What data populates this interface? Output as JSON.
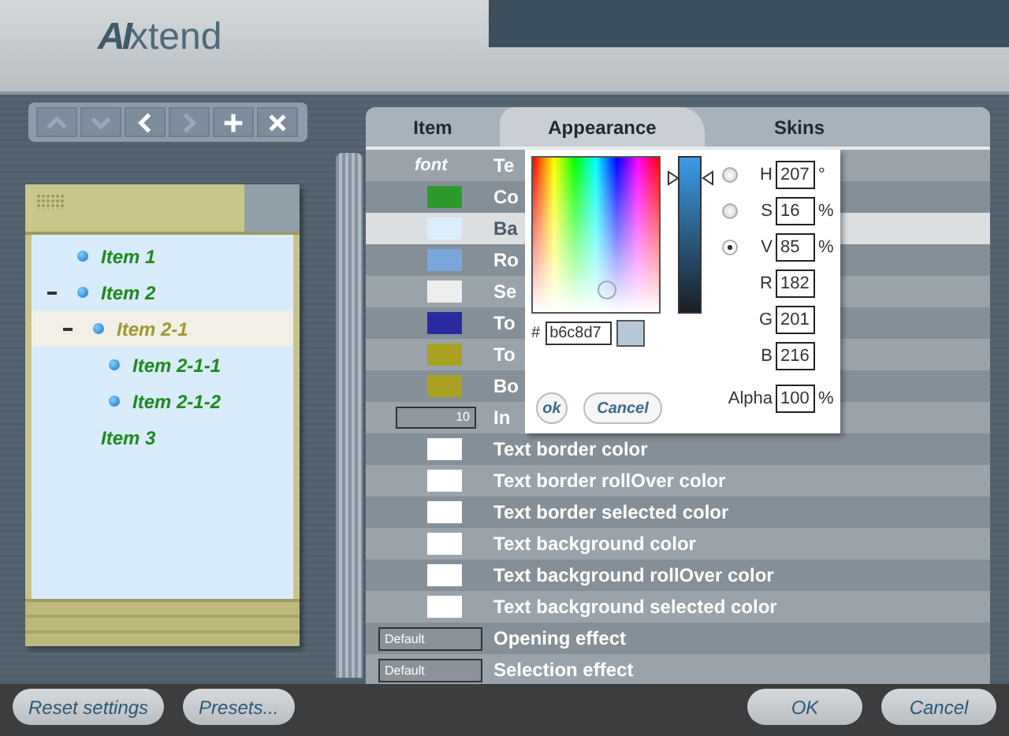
{
  "logo": {
    "mark": "AI",
    "text": "xtend"
  },
  "toolbar": [
    {
      "kind": "up",
      "disabled": true
    },
    {
      "kind": "down",
      "disabled": true
    },
    {
      "kind": "left",
      "disabled": false
    },
    {
      "kind": "right",
      "disabled": true
    },
    {
      "kind": "add",
      "disabled": false
    },
    {
      "kind": "remove",
      "disabled": false
    }
  ],
  "tree": {
    "items": [
      {
        "label": "Item 1",
        "bullet": true,
        "selected": false
      },
      {
        "label": "Item 2",
        "bullet": true,
        "selected": false,
        "expanded": true,
        "children": [
          {
            "label": "Item 2-1",
            "bullet": true,
            "selected": true,
            "expanded": true,
            "children": [
              {
                "label": "Item 2-1-1",
                "bullet": true,
                "selected": false
              },
              {
                "label": "Item 2-1-2",
                "bullet": true,
                "selected": false
              }
            ]
          }
        ]
      },
      {
        "label": "Item 3",
        "bullet": false,
        "selected": false
      }
    ]
  },
  "tabs": [
    {
      "label": "Item",
      "selected": false
    },
    {
      "label": "Appearance",
      "selected": true
    },
    {
      "label": "Skins",
      "selected": false
    }
  ],
  "rows": [
    {
      "kind": "font",
      "value": "font",
      "label": "Te",
      "selected": false
    },
    {
      "kind": "color",
      "color": "#2e9a2e",
      "label": "Co",
      "selected": false
    },
    {
      "kind": "color",
      "color": "#dceefc",
      "label": "Ba",
      "selected": true
    },
    {
      "kind": "color",
      "color": "#7aa6dc",
      "label": "Ro",
      "selected": false
    },
    {
      "kind": "color",
      "color": "#eeeeee",
      "label": "Se",
      "selected": false
    },
    {
      "kind": "color",
      "color": "#2a2aa0",
      "label": "To",
      "selected": false
    },
    {
      "kind": "color",
      "color": "#a8a020",
      "label": "To",
      "selected": false
    },
    {
      "kind": "color",
      "color": "#a8a020",
      "label": "Bo",
      "selected": false
    },
    {
      "kind": "number",
      "value": "10",
      "label": "In",
      "selected": false
    },
    {
      "kind": "color",
      "color": "#ffffff",
      "label": "Text border color",
      "selected": false
    },
    {
      "kind": "color",
      "color": "#ffffff",
      "label": "Text border rollOver color",
      "selected": false
    },
    {
      "kind": "color",
      "color": "#ffffff",
      "label": "Text border selected color",
      "selected": false
    },
    {
      "kind": "color",
      "color": "#ffffff",
      "label": "Text background color",
      "selected": false
    },
    {
      "kind": "color",
      "color": "#ffffff",
      "label": "Text background rollOver color",
      "selected": false
    },
    {
      "kind": "color",
      "color": "#ffffff",
      "label": "Text background selected color",
      "selected": false
    },
    {
      "kind": "select",
      "value": "Default",
      "label": "Opening effect",
      "selected": false
    },
    {
      "kind": "select",
      "value": "Default",
      "label": "Selection effect",
      "selected": false
    }
  ],
  "color_picker": {
    "hue_slider": {
      "level": 0.86
    },
    "hex_label": "#",
    "hex": "b6c8d7",
    "params": [
      {
        "kind": "radio",
        "label": "H",
        "value": "207",
        "unit": "°",
        "selected": false
      },
      {
        "kind": "radio",
        "label": "S",
        "value": "16",
        "unit": "%",
        "selected": false
      },
      {
        "kind": "radio",
        "label": "V",
        "value": "85",
        "unit": "%",
        "selected": true
      },
      {
        "kind": "plain",
        "label": "R",
        "value": "182"
      },
      {
        "kind": "plain",
        "label": "G",
        "value": "201"
      },
      {
        "kind": "plain",
        "label": "B",
        "value": "216"
      },
      {
        "kind": "alpha",
        "label": "Alpha",
        "value": "100",
        "unit": "%"
      }
    ],
    "ok": "ok",
    "cancel": "Cancel"
  },
  "footer": {
    "left": [
      "Reset settings",
      "Presets..."
    ],
    "right": [
      "OK",
      "Cancel"
    ]
  }
}
